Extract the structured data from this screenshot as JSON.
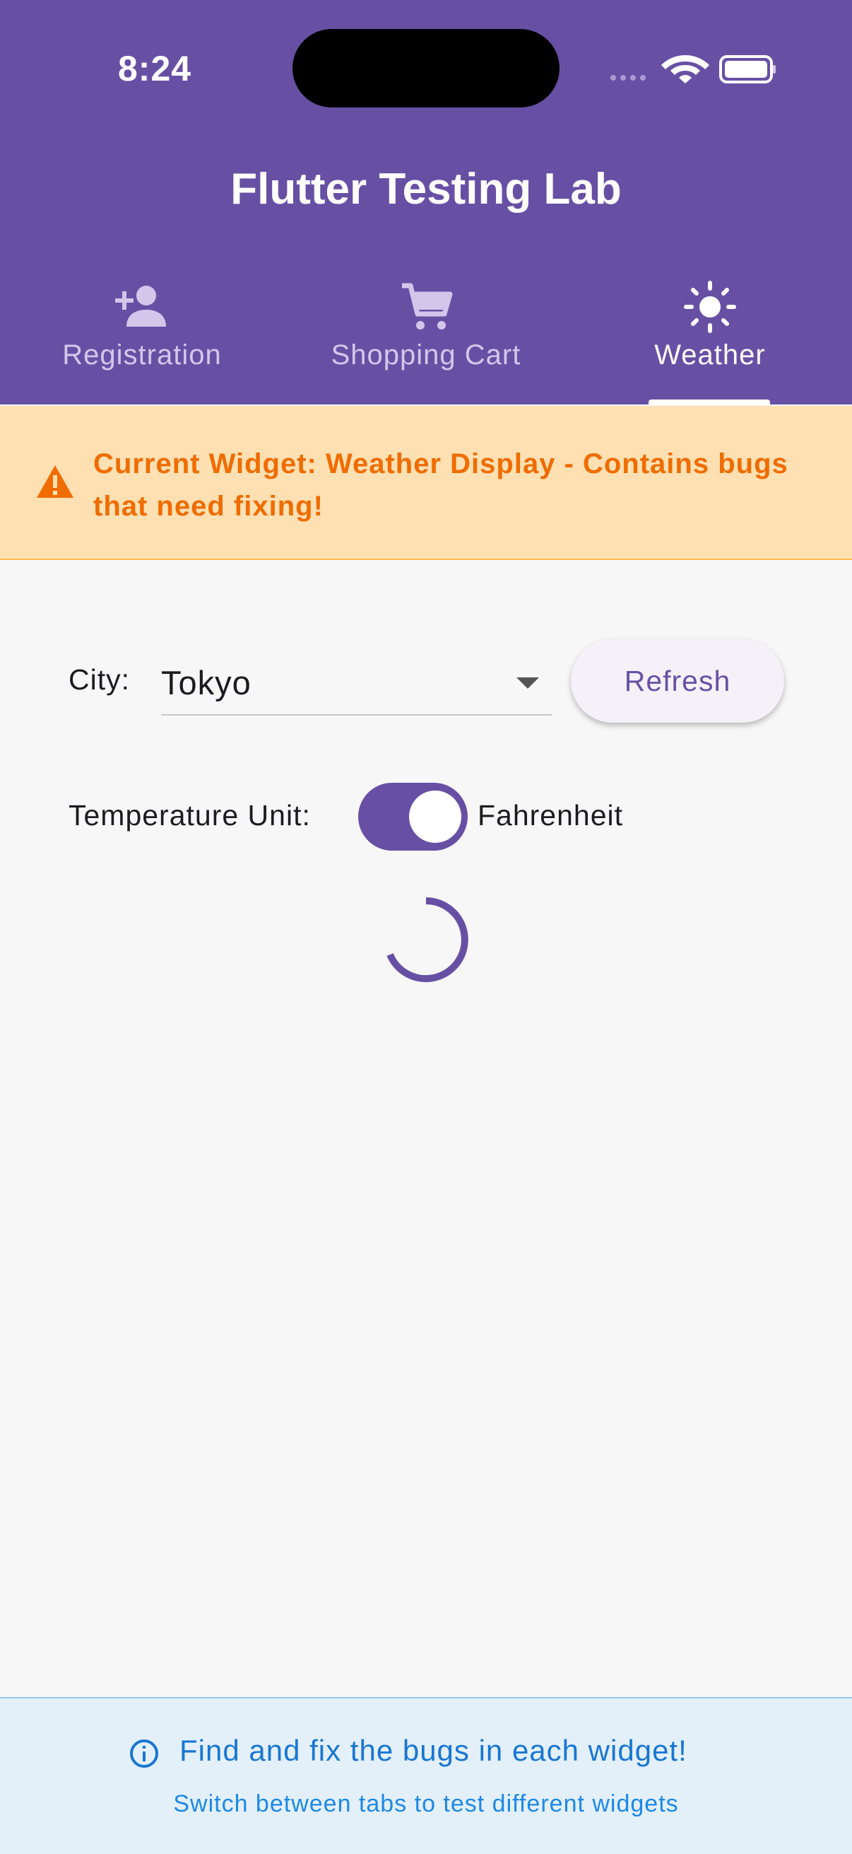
{
  "status_bar": {
    "time": "8:24",
    "icons": [
      "signal-dots-icon",
      "wifi-icon",
      "battery-icon"
    ]
  },
  "app_bar": {
    "title": "Flutter Testing Lab"
  },
  "tabs": [
    {
      "label": "Registration",
      "icon": "person-add-icon",
      "active": false
    },
    {
      "label": "Shopping Cart",
      "icon": "shopping-cart-icon",
      "active": false
    },
    {
      "label": "Weather",
      "icon": "sun-icon",
      "active": true
    }
  ],
  "warning": {
    "icon": "warning-icon",
    "text": "Current Widget: Weather Display - Contains bugs that need fixing!"
  },
  "weather": {
    "city_label": "City:",
    "city_value": "Tokyo",
    "refresh_label": "Refresh",
    "unit_label": "Temperature Unit:",
    "unit_toggle_on": true,
    "unit_value": "Fahrenheit",
    "loading": true
  },
  "footer": {
    "icon": "info-icon",
    "title": "Find and fix the bugs in each widget!",
    "subtitle": "Switch between tabs to test different widgets"
  },
  "colors": {
    "primary": "#6750a4",
    "warning_bg": "#ffe0b2",
    "warning_text": "#ef6c00",
    "info_bg": "#e3f0fa",
    "info_text": "#1976d2"
  }
}
